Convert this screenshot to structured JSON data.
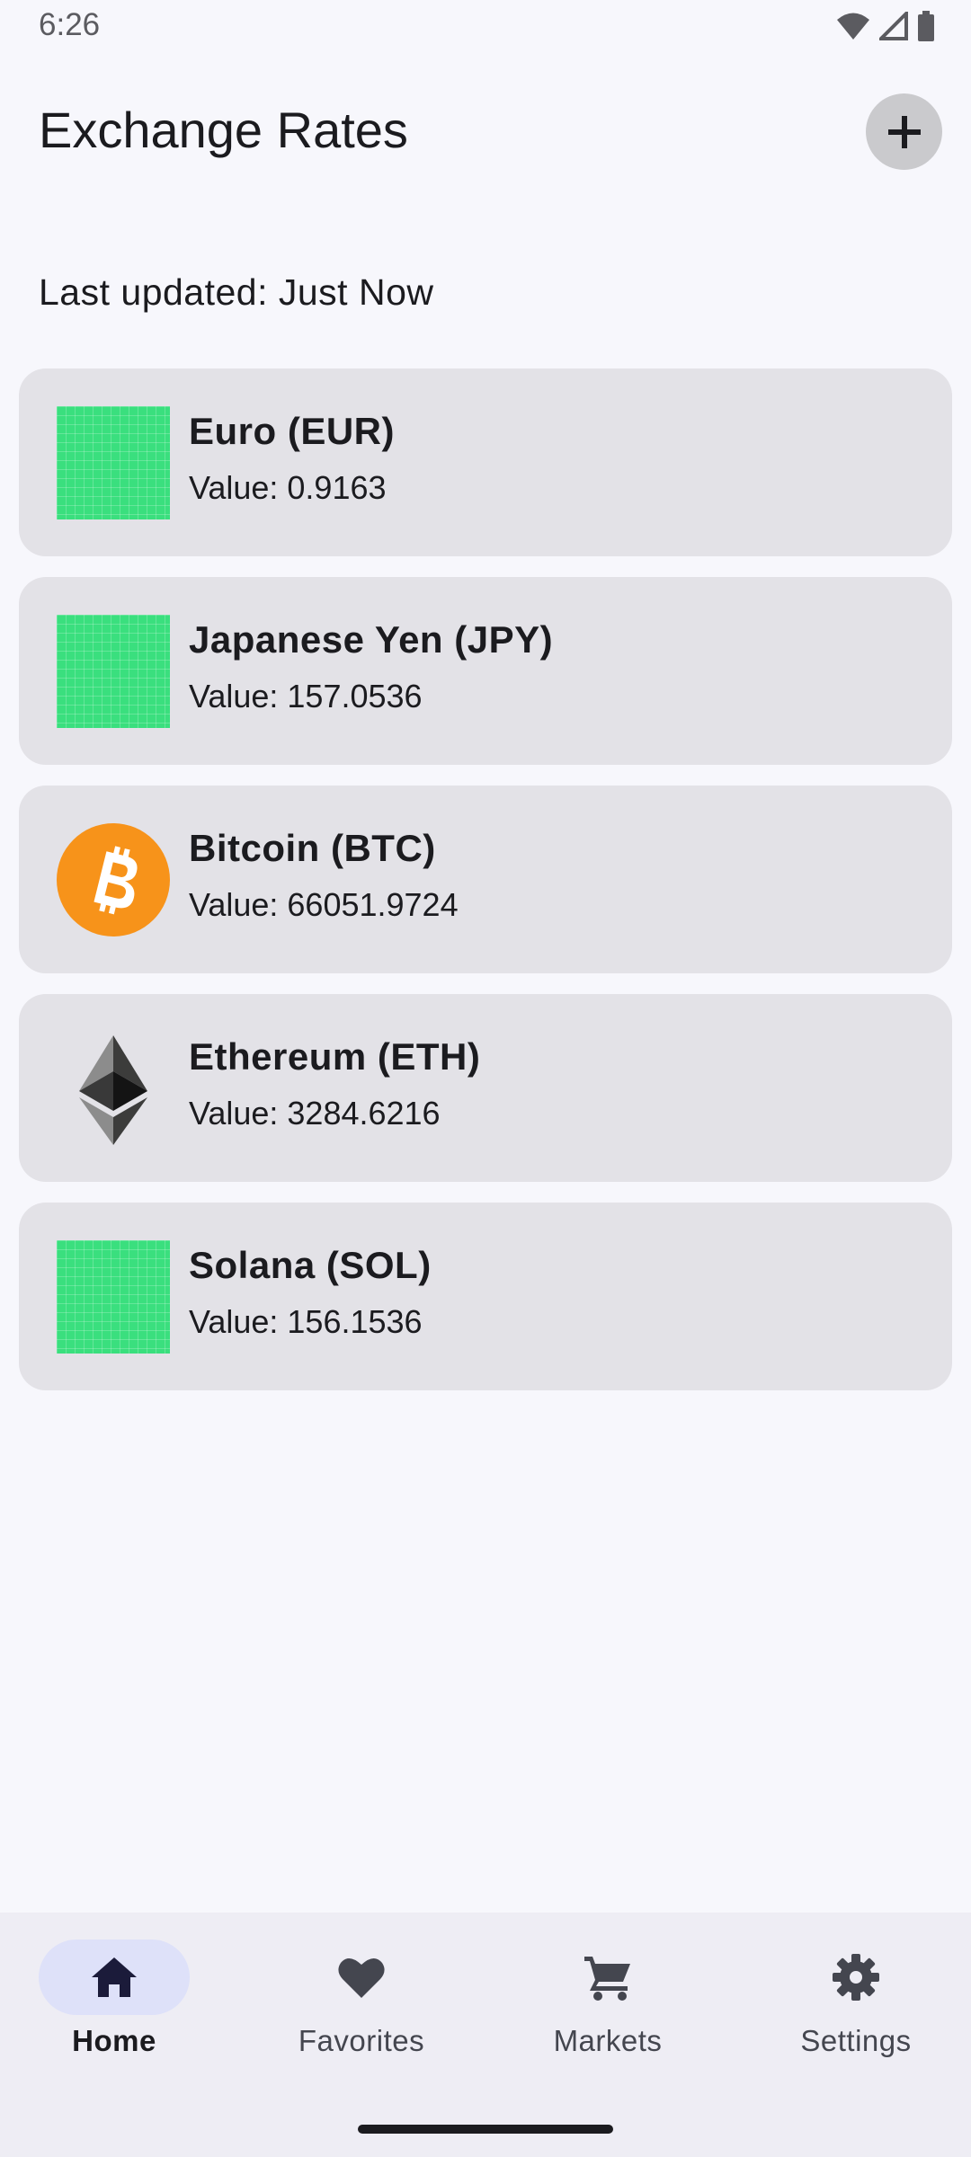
{
  "status_bar": {
    "time": "6:26"
  },
  "app_bar": {
    "title": "Exchange Rates",
    "add_icon": "plus-icon"
  },
  "last_updated": "Last updated: Just Now",
  "rates": [
    {
      "name": "Euro (EUR)",
      "value": "Value: 0.9163",
      "icon": "flag-placeholder"
    },
    {
      "name": "Japanese Yen (JPY)",
      "value": "Value: 157.0536",
      "icon": "flag-placeholder"
    },
    {
      "name": "Bitcoin (BTC)",
      "value": "Value: 66051.9724",
      "icon": "bitcoin-icon"
    },
    {
      "name": "Ethereum (ETH)",
      "value": "Value: 3284.6216",
      "icon": "ethereum-icon"
    },
    {
      "name": "Solana (SOL)",
      "value": "Value: 156.1536",
      "icon": "flag-placeholder"
    }
  ],
  "bottom_nav": {
    "items": [
      {
        "label": "Home",
        "icon": "home-icon",
        "active": true
      },
      {
        "label": "Favorites",
        "icon": "heart-icon",
        "active": false
      },
      {
        "label": "Markets",
        "icon": "cart-icon",
        "active": false
      },
      {
        "label": "Settings",
        "icon": "gear-icon",
        "active": false
      }
    ]
  },
  "colors": {
    "background": "#F7F7FC",
    "card": "#E3E2E7",
    "placeholder_green": "#3ADF7E",
    "bitcoin_orange": "#F7931A",
    "nav_active_pill": "#DEE1F9"
  }
}
